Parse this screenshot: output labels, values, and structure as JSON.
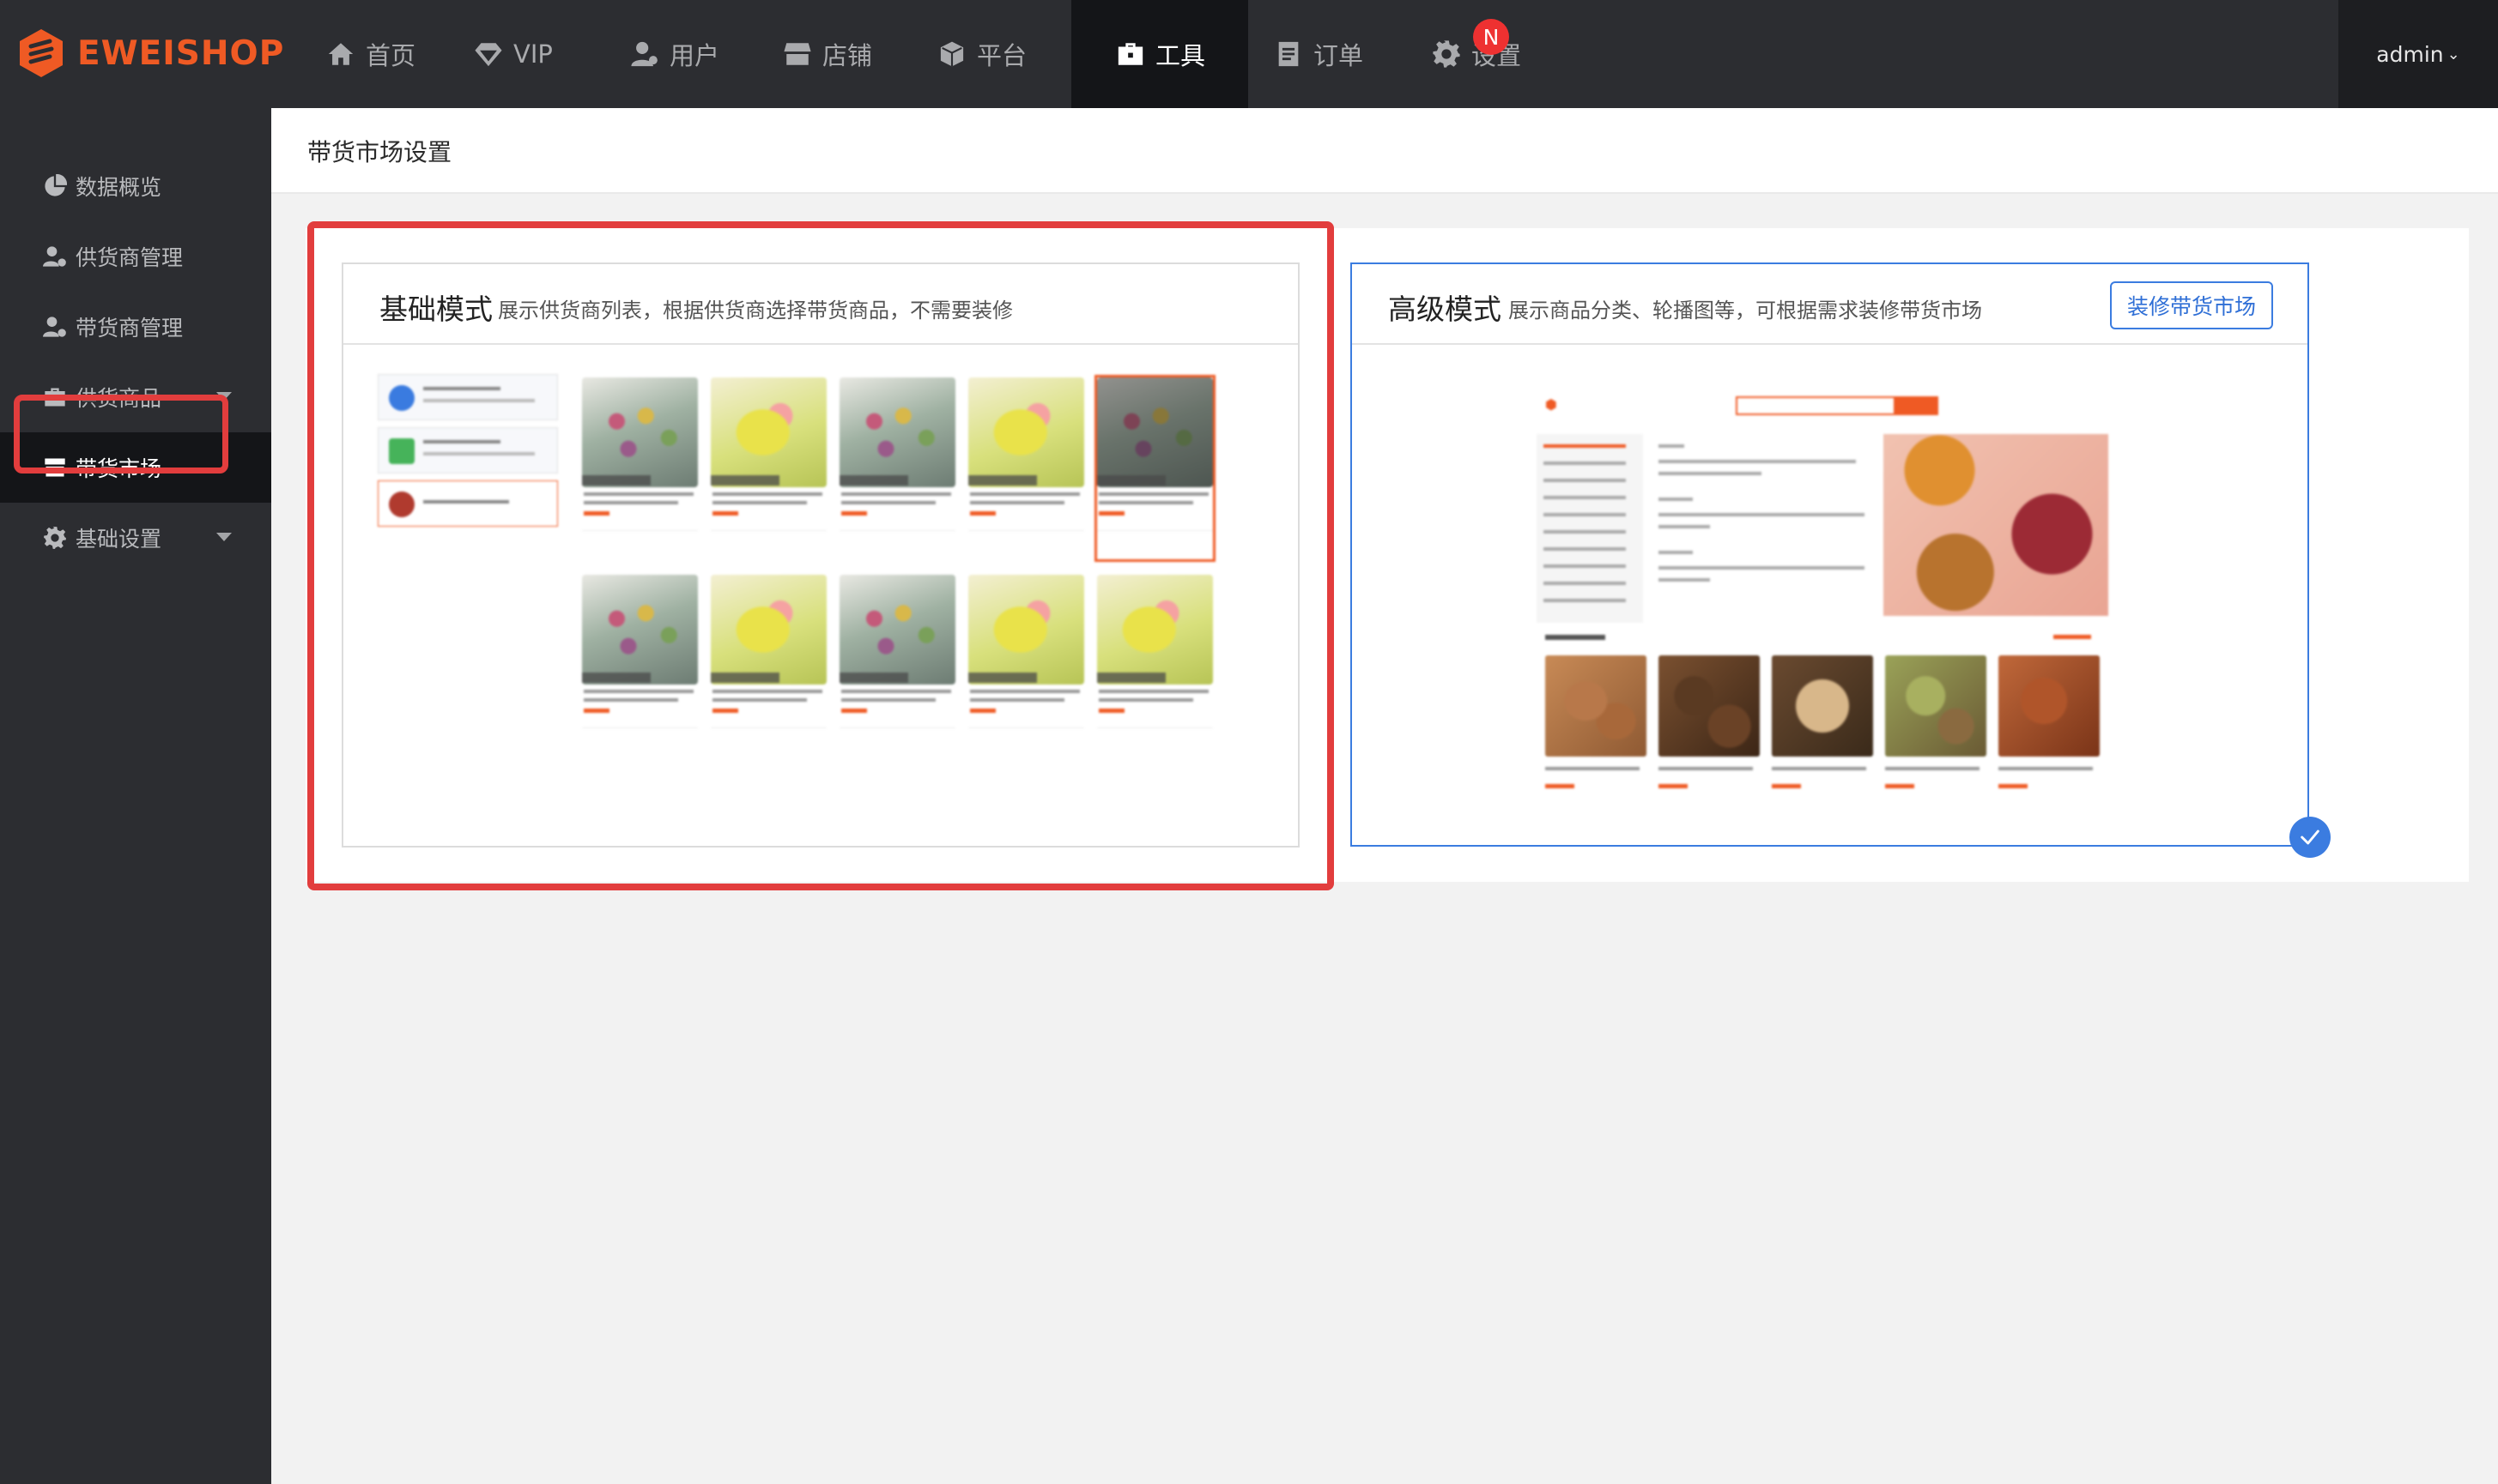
{
  "brand": {
    "name": "EWEISHOP",
    "color": "#ef5a24"
  },
  "topnav": {
    "items": [
      {
        "label": "首页",
        "icon": "home-icon"
      },
      {
        "label": "VIP",
        "icon": "diamond-icon"
      },
      {
        "label": "用户",
        "icon": "user-icon"
      },
      {
        "label": "店铺",
        "icon": "store-icon"
      },
      {
        "label": "平台",
        "icon": "cube-icon"
      },
      {
        "label": "工具",
        "icon": "toolbox-icon",
        "active": true
      },
      {
        "label": "订单",
        "icon": "document-icon"
      },
      {
        "label": "设置",
        "icon": "gear-icon",
        "badge": "N"
      }
    ],
    "user": "admin"
  },
  "sidebar": {
    "items": [
      {
        "label": "数据概览",
        "icon": "pie-chart-icon"
      },
      {
        "label": "供货商管理",
        "icon": "user-gear-icon"
      },
      {
        "label": "带货商管理",
        "icon": "user-gear-icon"
      },
      {
        "label": "供货商品",
        "icon": "bag-icon",
        "expandable": true
      },
      {
        "label": "带货市场",
        "icon": "storefront-icon",
        "active": true
      },
      {
        "label": "基础设置",
        "icon": "gear-icon",
        "expandable": true
      }
    ]
  },
  "page": {
    "title": "带货市场设置"
  },
  "modes": {
    "basic": {
      "title": "基础模式",
      "desc": "展示供货商列表，根据供货商选择带货商品，不需要装修"
    },
    "advanced": {
      "title": "高级模式",
      "desc": "展示商品分类、轮播图等，可根据需求装修带货市场",
      "button": "装修带货市场",
      "selected": true
    }
  },
  "colors": {
    "accent": "#3b7ce0",
    "highlight": "#e23d3d",
    "nav_bg": "#2c2d31",
    "nav_active_bg": "#141518"
  }
}
